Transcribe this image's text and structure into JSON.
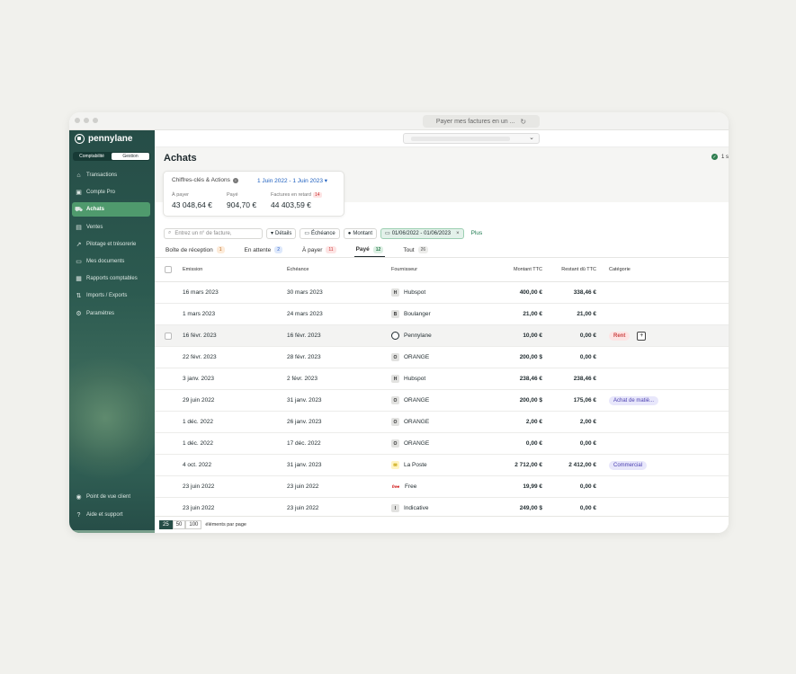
{
  "browser": {
    "url": "Payer mes factures en un ..."
  },
  "app": {
    "brand": "pennylane",
    "segments": [
      "Comptabilité",
      "Gestion"
    ],
    "nav": [
      {
        "label": "Transactions",
        "icon": "bank-icon"
      },
      {
        "label": "Compte Pro",
        "icon": "card-icon"
      },
      {
        "label": "Achats",
        "icon": "cart-icon",
        "active": true
      },
      {
        "label": "Ventes",
        "icon": "store-icon"
      },
      {
        "label": "Pilotage et trésorerie",
        "icon": "chart-icon"
      },
      {
        "label": "Mes documents",
        "icon": "folder-icon"
      },
      {
        "label": "Rapports comptables",
        "icon": "report-icon"
      },
      {
        "label": "Imports / Exports",
        "icon": "transfer-icon"
      },
      {
        "label": "Paramètres",
        "icon": "gear-icon"
      }
    ],
    "nav_bottom": [
      {
        "label": "Point de vue client",
        "icon": "eye-icon"
      },
      {
        "label": "Aide et support",
        "icon": "help-icon"
      }
    ]
  },
  "page": {
    "title": "Achats",
    "sync_text": "1 s"
  },
  "kpi": {
    "title": "Chiffres-clés & Actions",
    "range": "1 Juin 2022 - 1 Juin 2023",
    "cols": [
      {
        "label": "À payer",
        "value": "43 048,64 €"
      },
      {
        "label": "Payé",
        "value": "904,70 €"
      },
      {
        "label": "Factures en retard",
        "badge": "14",
        "value": "44 403,59 €"
      }
    ]
  },
  "filters": {
    "search_placeholder": "Entrez un n° de facture,",
    "details": "Détails",
    "echeance": "Échéance",
    "montant": "Montant",
    "date_range": "01/06/2022 - 01/06/2023",
    "plus": "Plus"
  },
  "tabs": [
    {
      "label": "Boîte de réception",
      "count": "1",
      "bg": "#fdebd9",
      "fg": "#b5651d"
    },
    {
      "label": "En attente",
      "count": "2",
      "bg": "#dde8fb",
      "fg": "#2c5cc5"
    },
    {
      "label": "À payer",
      "count": "11",
      "bg": "#fde4e4",
      "fg": "#c33"
    },
    {
      "label": "Payé",
      "count": "12",
      "bg": "#dcefe3",
      "fg": "#2e7d4f",
      "active": true
    },
    {
      "label": "Tout",
      "count": "26",
      "bg": "#ececea",
      "fg": "#555"
    }
  ],
  "table": {
    "headers": {
      "emission": "Emission",
      "echeance": "Échéance",
      "fournisseur": "Fournisseur",
      "montant": "Montant TTC",
      "restant": "Restant dû TTC",
      "categorie": "Catégorie"
    },
    "rows": [
      {
        "emission": "16 mars 2023",
        "echeance": "30 mars 2023",
        "icon": "H",
        "fournisseur": "Hubspot",
        "montant": "400,00 €",
        "restant": "338,46 €"
      },
      {
        "emission": "1 mars 2023",
        "echeance": "24 mars 2023",
        "icon": "B",
        "fournisseur": "Boulanger",
        "montant": "21,00 €",
        "restant": "21,00 €"
      },
      {
        "emission": "16 févr. 2023",
        "echeance": "16 févr. 2023",
        "icon": "",
        "fournisseur": "Pennylane",
        "montant": "10,00 €",
        "restant": "0,00 €",
        "tag": "Rent",
        "tagstyle": "red",
        "highlight": true
      },
      {
        "emission": "22 févr. 2023",
        "echeance": "28 févr. 2023",
        "icon": "O",
        "fournisseur": "ORANGE",
        "montant": "200,00 $",
        "restant": "0,00 €"
      },
      {
        "emission": "3 janv. 2023",
        "echeance": "2 févr. 2023",
        "icon": "H",
        "fournisseur": "Hubspot",
        "montant": "238,46 €",
        "restant": "238,46 €"
      },
      {
        "emission": "29 juin 2022",
        "echeance": "31 janv. 2023",
        "icon": "O",
        "fournisseur": "ORANGE",
        "montant": "200,00 $",
        "restant": "175,06 €",
        "tag": "Achat de matiè...",
        "tagstyle": "violet"
      },
      {
        "emission": "1 déc. 2022",
        "echeance": "26 janv. 2023",
        "icon": "O",
        "fournisseur": "ORANGE",
        "montant": "2,00 €",
        "restant": "2,00 €"
      },
      {
        "emission": "1 déc. 2022",
        "echeance": "17 déc. 2022",
        "icon": "O",
        "fournisseur": "ORANGE",
        "montant": "0,00 €",
        "restant": "0,00 €"
      },
      {
        "emission": "4 oct. 2022",
        "echeance": "31 janv. 2023",
        "icon": "",
        "fournisseur": "La Poste",
        "montant": "2 712,00 €",
        "restant": "2 412,00 €",
        "tag": "Commercial",
        "tagstyle": "violet"
      },
      {
        "emission": "23 juin 2022",
        "echeance": "23 juin 2022",
        "icon": "free",
        "fournisseur": "Free",
        "montant": "19,99 €",
        "restant": "0,00 €"
      },
      {
        "emission": "23 juin 2022",
        "echeance": "23 juin 2022",
        "icon": "I",
        "fournisseur": "Indicative",
        "montant": "249,00 $",
        "restant": "0,00 €"
      }
    ]
  },
  "pager": {
    "sizes": [
      "25",
      "50",
      "100"
    ],
    "active": "25",
    "label": "éléments par page"
  },
  "colors": {
    "sidebar": "#264d47",
    "accent": "#4f9a6d",
    "link": "#1d5fbf"
  }
}
